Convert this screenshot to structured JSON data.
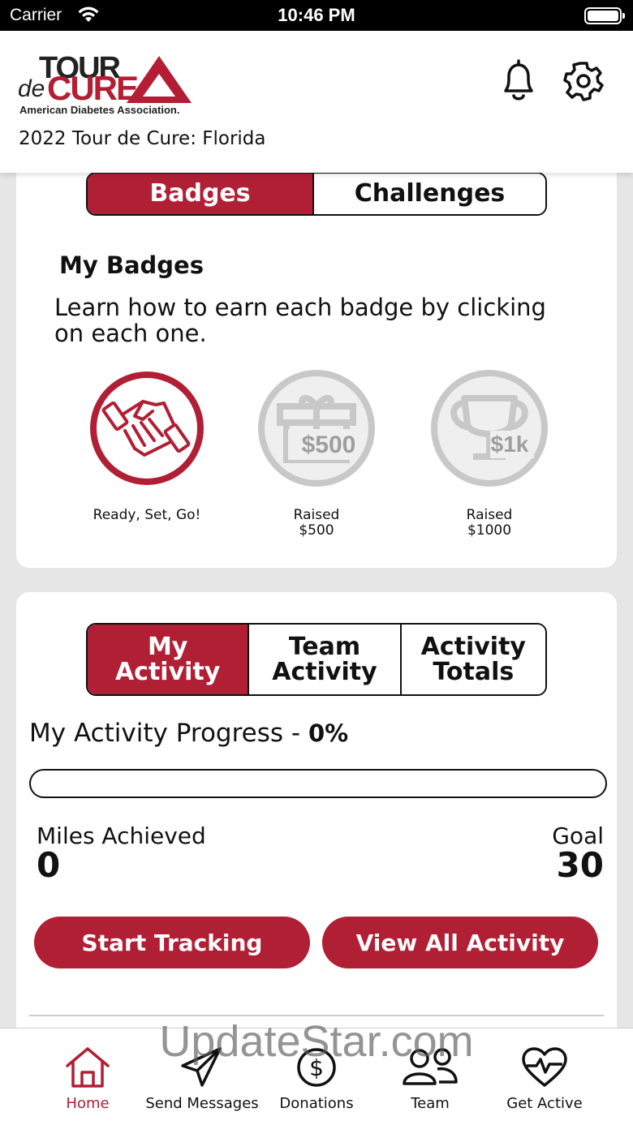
{
  "status_bar": {
    "carrier": "Carrier",
    "time": "10:46 PM"
  },
  "header": {
    "logo": {
      "tour": "TOUR",
      "de": "de",
      "cure": "CURE",
      "org": "American Diabetes Association."
    },
    "event_name": "2022 Tour de Cure: Florida",
    "bell_icon": "bell-icon",
    "gear_icon": "gear-icon"
  },
  "badges_card": {
    "tabs": [
      {
        "label": "Badges",
        "active": true
      },
      {
        "label": "Challenges",
        "active": false
      }
    ],
    "title": "My Badges",
    "hint": "Learn how to earn each badge by clicking on each one.",
    "badges": [
      {
        "label_line1": "Ready, Set, Go!",
        "label_line2": "",
        "icon": "handshake-icon",
        "earned": true,
        "amount": ""
      },
      {
        "label_line1": "Raised",
        "label_line2": "$500",
        "icon": "gift-icon",
        "earned": false,
        "amount": "$500"
      },
      {
        "label_line1": "Raised",
        "label_line2": "$1000",
        "icon": "trophy-icon",
        "earned": false,
        "amount": "$1k"
      }
    ]
  },
  "activity_card": {
    "tabs": [
      {
        "label": "My Activity",
        "active": true
      },
      {
        "label": "Team Activity",
        "active": false
      },
      {
        "label": "Activity Totals",
        "active": false
      }
    ],
    "progress_title": "My Activity Progress",
    "progress_separator": " - ",
    "progress_percent": "0%",
    "progress_fraction": 0,
    "miles_label": "Miles Achieved",
    "miles_value": "0",
    "goal_label": "Goal",
    "goal_value": "30",
    "buttons": {
      "start": "Start Tracking",
      "view_all": "View All Activity"
    }
  },
  "tab_bar": {
    "items": [
      {
        "label": "Home",
        "icon": "home-icon",
        "active": true
      },
      {
        "label": "Send Messages",
        "icon": "send-icon",
        "active": false
      },
      {
        "label": "Donations",
        "icon": "dollar-icon",
        "active": false
      },
      {
        "label": "Team",
        "icon": "team-icon",
        "active": false
      },
      {
        "label": "Get Active",
        "icon": "heart-pulse-icon",
        "active": false
      }
    ]
  },
  "colors": {
    "brand_red": "#b11f35",
    "badge_gray": "#c8c8c8",
    "background": "#e6e6e6"
  },
  "watermark": "UpdateStar.com"
}
